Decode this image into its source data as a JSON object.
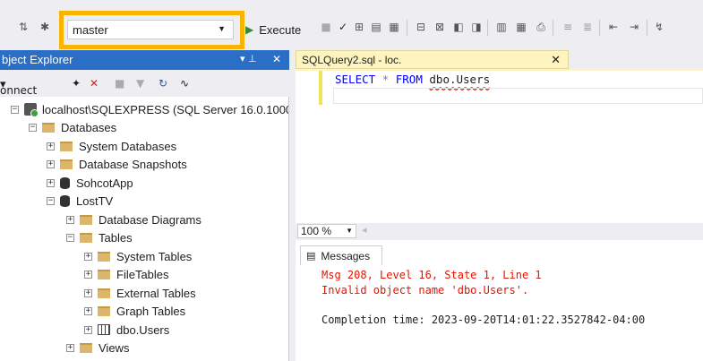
{
  "toolbar": {
    "database_selector": {
      "value": "master"
    },
    "execute_label": "Execute"
  },
  "object_explorer": {
    "title": "bject Explorer",
    "pin_glyph": "▾ ⊥",
    "close_glyph": "✕",
    "connect_label": "onnect",
    "tree": [
      {
        "label": "localhost\\SQLEXPRESS (SQL Server 16.0.1000 -",
        "icon": "server-icon",
        "level": 0,
        "expander": "−"
      },
      {
        "label": "Databases",
        "icon": "folder-icon",
        "level": 1,
        "expander": "−"
      },
      {
        "label": "System Databases",
        "icon": "folder-icon",
        "level": 2,
        "expander": "+"
      },
      {
        "label": "Database Snapshots",
        "icon": "folder-icon",
        "level": 2,
        "expander": "+"
      },
      {
        "label": "SohcotApp",
        "icon": "database-icon",
        "level": 2,
        "expander": "+"
      },
      {
        "label": "LostTV",
        "icon": "database-icon",
        "level": 2,
        "expander": "−"
      },
      {
        "label": "Database Diagrams",
        "icon": "folder-icon",
        "level": 3,
        "expander": "+"
      },
      {
        "label": "Tables",
        "icon": "folder-icon",
        "level": 3,
        "expander": "−"
      },
      {
        "label": "System Tables",
        "icon": "folder-icon",
        "level": 4,
        "expander": "+"
      },
      {
        "label": "FileTables",
        "icon": "folder-icon",
        "level": 4,
        "expander": "+"
      },
      {
        "label": "External Tables",
        "icon": "folder-icon",
        "level": 4,
        "expander": "+"
      },
      {
        "label": "Graph Tables",
        "icon": "folder-icon",
        "level": 4,
        "expander": "+"
      },
      {
        "label": "dbo.Users",
        "icon": "table-icon",
        "level": 4,
        "expander": "+"
      },
      {
        "label": "Views",
        "icon": "folder-icon",
        "level": 3,
        "expander": "+"
      }
    ]
  },
  "editor": {
    "tab_title": "SQLQuery2.sql - loc.",
    "tab_close": "✕",
    "query": {
      "kw_select": "SELECT",
      "star": "*",
      "kw_from": "FROM",
      "object": "dbo.Users"
    }
  },
  "zoom": {
    "value": "100 %"
  },
  "results": {
    "tab_label": "Messages",
    "lines": [
      "Msg 208, Level 16, State 1, Line 1",
      "Invalid object name 'dbo.Users'.",
      "Completion time: 2023-09-20T14:01:22.3527842-04:00"
    ]
  },
  "colors": {
    "highlight": "#f9b400",
    "title_bar": "#2a6fc5",
    "error_text": "#e51400",
    "keyword": "#0000ff"
  }
}
